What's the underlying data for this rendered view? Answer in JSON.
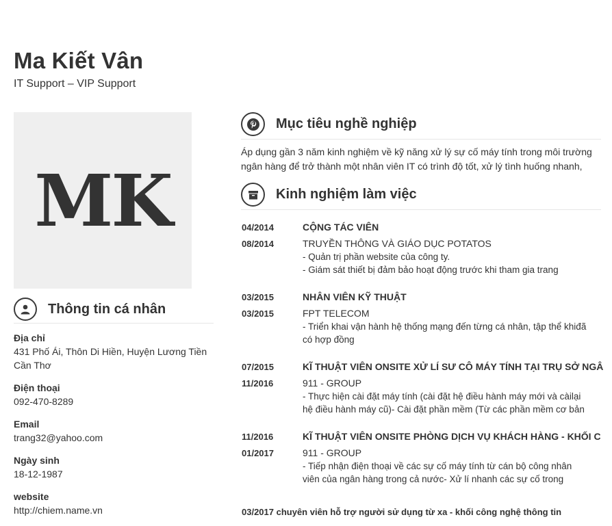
{
  "header": {
    "name": "Ma Kiết Vân",
    "subtitle": "IT Support – VIP Support"
  },
  "avatar": {
    "initials": "MK"
  },
  "personal": {
    "title": "Thông tin cá nhân",
    "icon": "user-icon",
    "items": [
      {
        "label": "Địa chỉ",
        "value": "431 Phố Ái, Thôn Di Hiền, Huyện Lương Tiền\nCần Thơ"
      },
      {
        "label": "Điện thoại",
        "value": "092-470-8289"
      },
      {
        "label": "Email",
        "value": "trang32@yahoo.com"
      },
      {
        "label": "Ngày sinh",
        "value": "18-12-1987"
      },
      {
        "label": "website",
        "value": "http://chiem.name.vn"
      }
    ]
  },
  "objective": {
    "title": "Mục tiêu nghề nghiệp",
    "icon": "pinterest-icon",
    "line1": "Áp dụng gần 3 năm kinh nghiệm về kỹ năng xử lý sự cố máy tính trong môi trường",
    "line2": "ngân hàng để trở thành một nhân viên IT có trình độ tốt, xử lý tình huống nhanh,"
  },
  "experience": {
    "title": "Kinh nghiệm làm việc",
    "icon": "archive-icon",
    "jobs": [
      {
        "start": "04/2014",
        "end": "08/2014",
        "title": "CỘNG TÁC VIÊN",
        "company": "TRUYỀN THÔNG VÀ GIÁO DỤC POTATOS",
        "desc": "- Quản trị phần website của công ty.\n- Giám sát thiết bị đảm bảo hoạt động trước khi tham gia trang"
      },
      {
        "start": "03/2015",
        "end": "03/2015",
        "title": "NHÂN VIÊN KỸ THUẬT",
        "company": "FPT TELECOM",
        "desc": "- Triển khai vận hành hệ thống mạng đến từng cá nhân, tập thể khiđã\ncó hợp đồng"
      },
      {
        "start": "07/2015",
        "end": "11/2016",
        "title": "KĨ THUẬT VIÊN ONSITE XỬ LÍ SƯ CÔ MÁY TÍNH TẠI TRỤ SỞ NGÂ",
        "company": "911 - GROUP",
        "desc": "- Thực hiện cài đặt máy tính (cài đặt hệ điều hành máy mới và càilại\nhệ điều hành máy cũ)- Cài đặt phần mềm (Từ các phần mềm cơ bản"
      },
      {
        "start": "11/2016",
        "end": "01/2017",
        "title": "KĨ THUẬT VIÊN ONSITE PHÒNG DỊCH VỤ KHÁCH HÀNG - KHỐI C",
        "company": "911 - GROUP",
        "desc": "- Tiếp nhận điện thoại về các sự cố máy tính từ cán bộ công nhân\nviên của ngân hàng trong cả nước- Xử lí nhanh các sự cố trong"
      }
    ],
    "partial": "03/2017      chuyên viên hỗ trợ người sử dụng từ xa - khối công nghệ thông tin"
  }
}
